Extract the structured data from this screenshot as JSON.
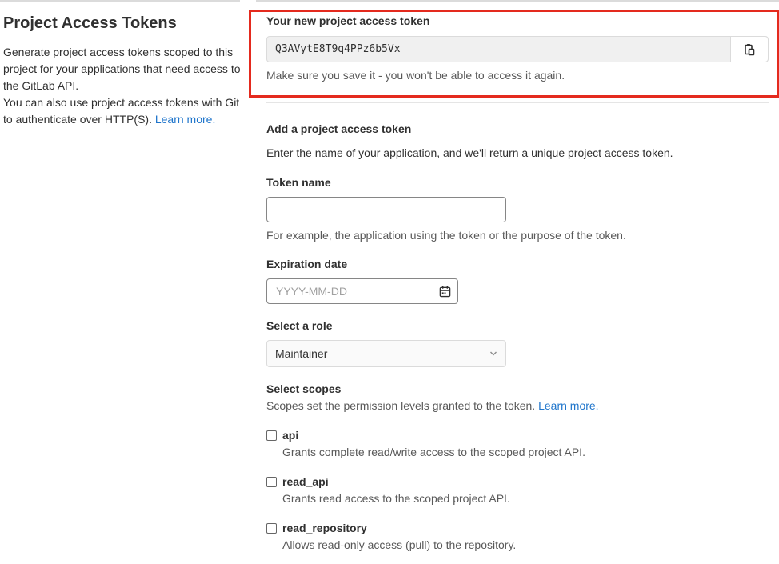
{
  "sidebar": {
    "title": "Project Access Tokens",
    "description": "Generate project access tokens scoped to this project for your applications that need access to the GitLab API.",
    "description2": "You can also use project access tokens with Git to authenticate over HTTP(S).",
    "learn_more": "Learn more."
  },
  "new_token": {
    "label": "Your new project access token",
    "value": "Q3AVytE8T9q4PPz6b5Vx",
    "copy_icon": "clipboard-icon",
    "note": "Make sure you save it - you won't be able to access it again."
  },
  "form": {
    "heading": "Add a project access token",
    "intro": "Enter the name of your application, and we'll return a unique project access token.",
    "token_name": {
      "label": "Token name",
      "value": "",
      "help": "For example, the application using the token or the purpose of the token."
    },
    "expiration": {
      "label": "Expiration date",
      "placeholder": "YYYY-MM-DD",
      "icon": "calendar-icon"
    },
    "role": {
      "label": "Select a role",
      "selected": "Maintainer"
    },
    "scopes": {
      "label": "Select scopes",
      "help": "Scopes set the permission levels granted to the token.",
      "learn_more": "Learn more.",
      "items": [
        {
          "name": "api",
          "desc": "Grants complete read/write access to the scoped project API.",
          "checked": false
        },
        {
          "name": "read_api",
          "desc": "Grants read access to the scoped project API.",
          "checked": false
        },
        {
          "name": "read_repository",
          "desc": "Allows read-only access (pull) to the repository.",
          "checked": false
        }
      ]
    }
  },
  "colors": {
    "highlight": "#e42a1e",
    "link": "#1f75cb"
  }
}
